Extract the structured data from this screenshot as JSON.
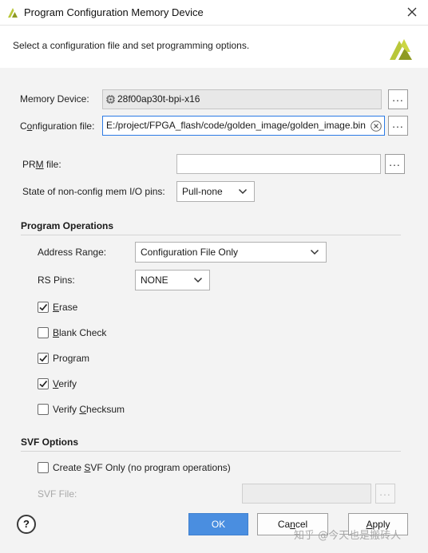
{
  "window": {
    "title": "Program Configuration Memory Device",
    "description": "Select a configuration file and set programming options."
  },
  "memory_device": {
    "label": "Memory Device:",
    "value": "28f00ap30t-bpi-x16"
  },
  "configuration_file": {
    "label_pre": "C",
    "label_u": "o",
    "label_post": "nfiguration file:",
    "value": "E:/project/FPGA_flash/code/golden_image/golden_image.bin"
  },
  "prm_file": {
    "label_pre": "PR",
    "label_u": "M",
    "label_post": " file:",
    "value": ""
  },
  "state_pins": {
    "label": "State of non-config mem I/O pins:",
    "selected": "Pull-none"
  },
  "program_operations": {
    "heading": "Program Operations",
    "address_range": {
      "label_pre": "Address Ran",
      "label_u": "g",
      "label_post": "e:",
      "selected": "Configuration File Only"
    },
    "rs_pins": {
      "label": "RS Pins:",
      "selected": "NONE"
    },
    "checkboxes": [
      {
        "pre": "",
        "u": "E",
        "post": "rase",
        "checked": true
      },
      {
        "pre": "",
        "u": "B",
        "post": "lank Check",
        "checked": false
      },
      {
        "pre": "Pro",
        "u": "g",
        "post": "ram",
        "checked": true
      },
      {
        "pre": "",
        "u": "V",
        "post": "erify",
        "checked": true
      },
      {
        "pre": "Verify ",
        "u": "C",
        "post": "hecksum",
        "checked": false
      }
    ]
  },
  "svf_options": {
    "heading": "SVF Options",
    "create_svf": {
      "pre": "Create ",
      "u": "S",
      "post": "VF Only (no program operations)",
      "checked": false
    },
    "svf_file_label": "SVF File:",
    "svf_file_value": ""
  },
  "buttons": {
    "help": "?",
    "ok": "OK",
    "cancel_pre": "Ca",
    "cancel_u": "n",
    "cancel_post": "cel",
    "apply_pre": "",
    "apply_u": "A",
    "apply_post": "pply",
    "browse": "..."
  },
  "watermark": "知乎 @今天也是搬砖人",
  "colors": {
    "accent": "#4a8ee0",
    "focus_border": "#2c7be5",
    "logo": "#b9c73a"
  }
}
